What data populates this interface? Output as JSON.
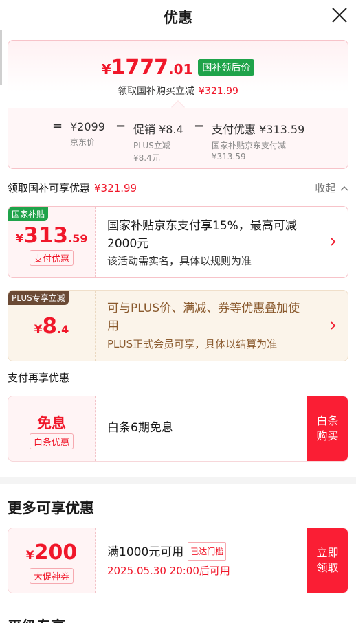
{
  "header": {
    "title": "优惠"
  },
  "summary": {
    "yen": "¥",
    "final_int": "1777",
    "final_dec": ".01",
    "badge": "国补领后价",
    "subline_text": "领取国补购买立减",
    "subline_amount": "¥321.99",
    "calc": {
      "eq": "=",
      "minus": "−",
      "jd_price": "¥2099",
      "jd_label": "京东价",
      "promo": "促销 ¥8.4",
      "promo_sub1": "PLUS立减",
      "promo_sub2": "¥8.4元",
      "pay": "支付优惠 ¥313.59",
      "pay_sub1": "国家补贴京东支付减",
      "pay_sub2": "¥313.59"
    }
  },
  "section1": {
    "label": "领取国补可享优惠",
    "amount": "¥321.99",
    "collapse": "收起"
  },
  "offers": [
    {
      "tag": "国家补贴",
      "yen": "¥",
      "amount_int": "313",
      "amount_dec": ".59",
      "pill": "支付优惠",
      "desc_line1": "国家补贴京东支付享15%，最高可减",
      "desc_line2": "2000元",
      "sub": "该活动需实名，具体以规则为准"
    },
    {
      "tag": "PLUS专享立减",
      "yen": "¥",
      "amount_int": "8",
      "amount_dec": ".4",
      "desc_line1": "可与PLUS价、满减、券等优惠叠加使",
      "desc_line2": "用",
      "sub": "PLUS正式会员可享，具体以结算为准"
    }
  ],
  "section2": {
    "label": "支付再享优惠"
  },
  "baitiao": {
    "title": "免息",
    "pill": "白条优惠",
    "desc": "白条6期免息",
    "button_line1": "白条",
    "button_line2": "购买"
  },
  "more": {
    "title": "更多可享优惠",
    "coupon": {
      "yen": "¥",
      "amount": "200",
      "pill": "大促神券",
      "desc": "满1000元可用",
      "met": "已达门槛",
      "time": "2025.05.30 20:00后可用",
      "button_line1": "立即",
      "button_line2": "领取"
    }
  },
  "cutoff_text": "平级专享",
  "colors": {
    "accent": "#f0172a",
    "green_badge": "#1fa34a",
    "plus_tag": "#6b4a35"
  }
}
